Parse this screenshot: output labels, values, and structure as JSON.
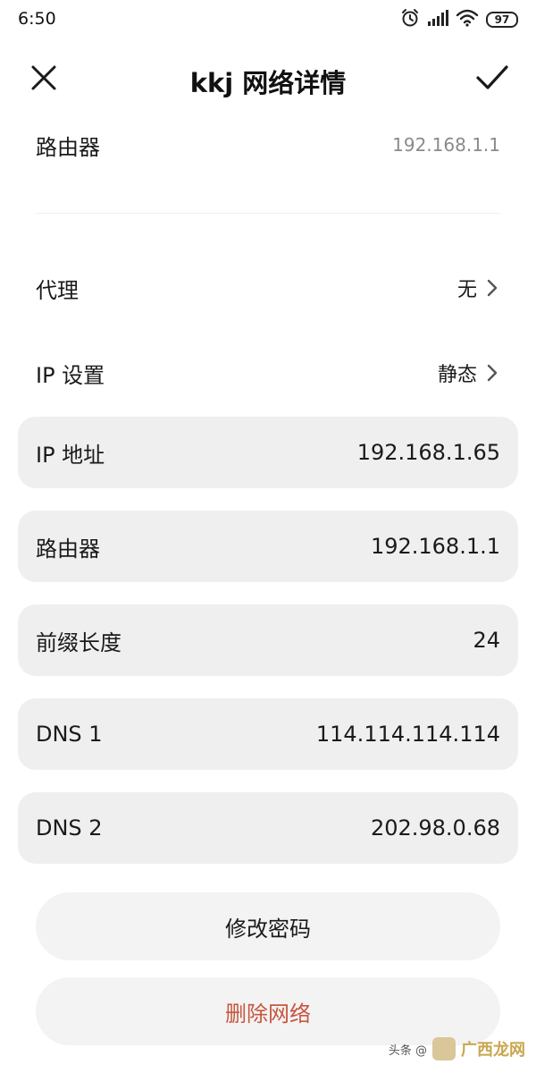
{
  "status_bar": {
    "time": "6:50",
    "battery": "97"
  },
  "header": {
    "title": "kkj 网络详情"
  },
  "info_rows": [
    {
      "label": "路由器",
      "value": "192.168.1.1"
    },
    {
      "label": "代理",
      "value": "无"
    },
    {
      "label": "IP 设置",
      "value": "静态"
    }
  ],
  "fields": [
    {
      "label": "IP 地址",
      "value": "192.168.1.65"
    },
    {
      "label": "路由器",
      "value": "192.168.1.1"
    },
    {
      "label": "前缀长度",
      "value": "24"
    },
    {
      "label": "DNS 1",
      "value": "114.114.114.114"
    },
    {
      "label": "DNS 2",
      "value": "202.98.0.68"
    }
  ],
  "actions": {
    "modify_password": "修改密码",
    "delete_network": "删除网络"
  },
  "watermark": {
    "text": "头条 @",
    "brand": "广西龙网"
  },
  "colors": {
    "danger": "#c8563f",
    "field_bg": "#efefef",
    "button_bg": "#f3f3f3"
  }
}
